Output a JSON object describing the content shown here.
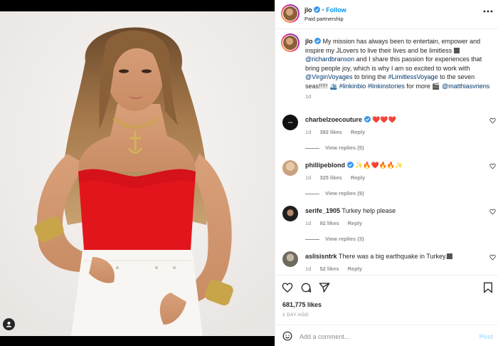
{
  "post": {
    "username": "jlo",
    "follow_label": "Follow",
    "separator": "•",
    "subtitle": "Paid partnership"
  },
  "caption": {
    "username": "jlo",
    "text_1": " My mission has always been to entertain, empower and inspire my JLovers to live their lives and be limitless ",
    "mention_1": "@richardbranson",
    "text_2": " and I share this passion for experiences that bring people joy, which is why I am so excited to work with ",
    "mention_2": "@VirginVoyages",
    "text_3": " to bring the ",
    "hashtag_1": "#LimitlessVoyage",
    "text_4": " to the seven seas!!!!! ",
    "hashtag_2": "#linkinbio",
    "hashtag_3": "#linkinstories",
    "text_5": " for more ",
    "mention_3": "@matthiasvriens",
    "age": "1d"
  },
  "comments": [
    {
      "username": "charbelzoecouture",
      "text": "❤️❤️❤️",
      "age": "1d",
      "likes": "382 likes",
      "reply": "Reply",
      "view_replies": "View replies (5)",
      "avatar_color": "#111111"
    },
    {
      "username": "phillipeblond",
      "text": "✨🔥❤️🔥🔥✨",
      "age": "1d",
      "likes": "325 likes",
      "reply": "Reply",
      "view_replies": "View replies (9)",
      "avatar_color": "#c9a27e"
    },
    {
      "username": "serife_1905",
      "text": "Turkey help please",
      "age": "1d",
      "likes": "92 likes",
      "reply": "Reply",
      "view_replies": "View replies (3)",
      "avatar_color": "#2b2b2b"
    },
    {
      "username": "aslisisntrk",
      "text": "There was a big earthquake in Turkey.",
      "age": "1d",
      "likes": "52 likes",
      "reply": "Reply",
      "avatar_color": "#6d6a5e"
    }
  ],
  "likes_count": "681,775 likes",
  "post_time": "1 DAY AGO",
  "add_comment": {
    "placeholder": "Add a comment...",
    "post_label": "Post"
  },
  "colors": {
    "link": "#00376b",
    "follow": "#0095f6",
    "muted": "#8e8e8e",
    "heart_red": "#ed4956"
  },
  "icons": [
    "more-icon",
    "heart-icon",
    "comment-icon",
    "share-icon",
    "bookmark-icon",
    "emoji-icon",
    "verified-icon",
    "tag-user-icon"
  ]
}
